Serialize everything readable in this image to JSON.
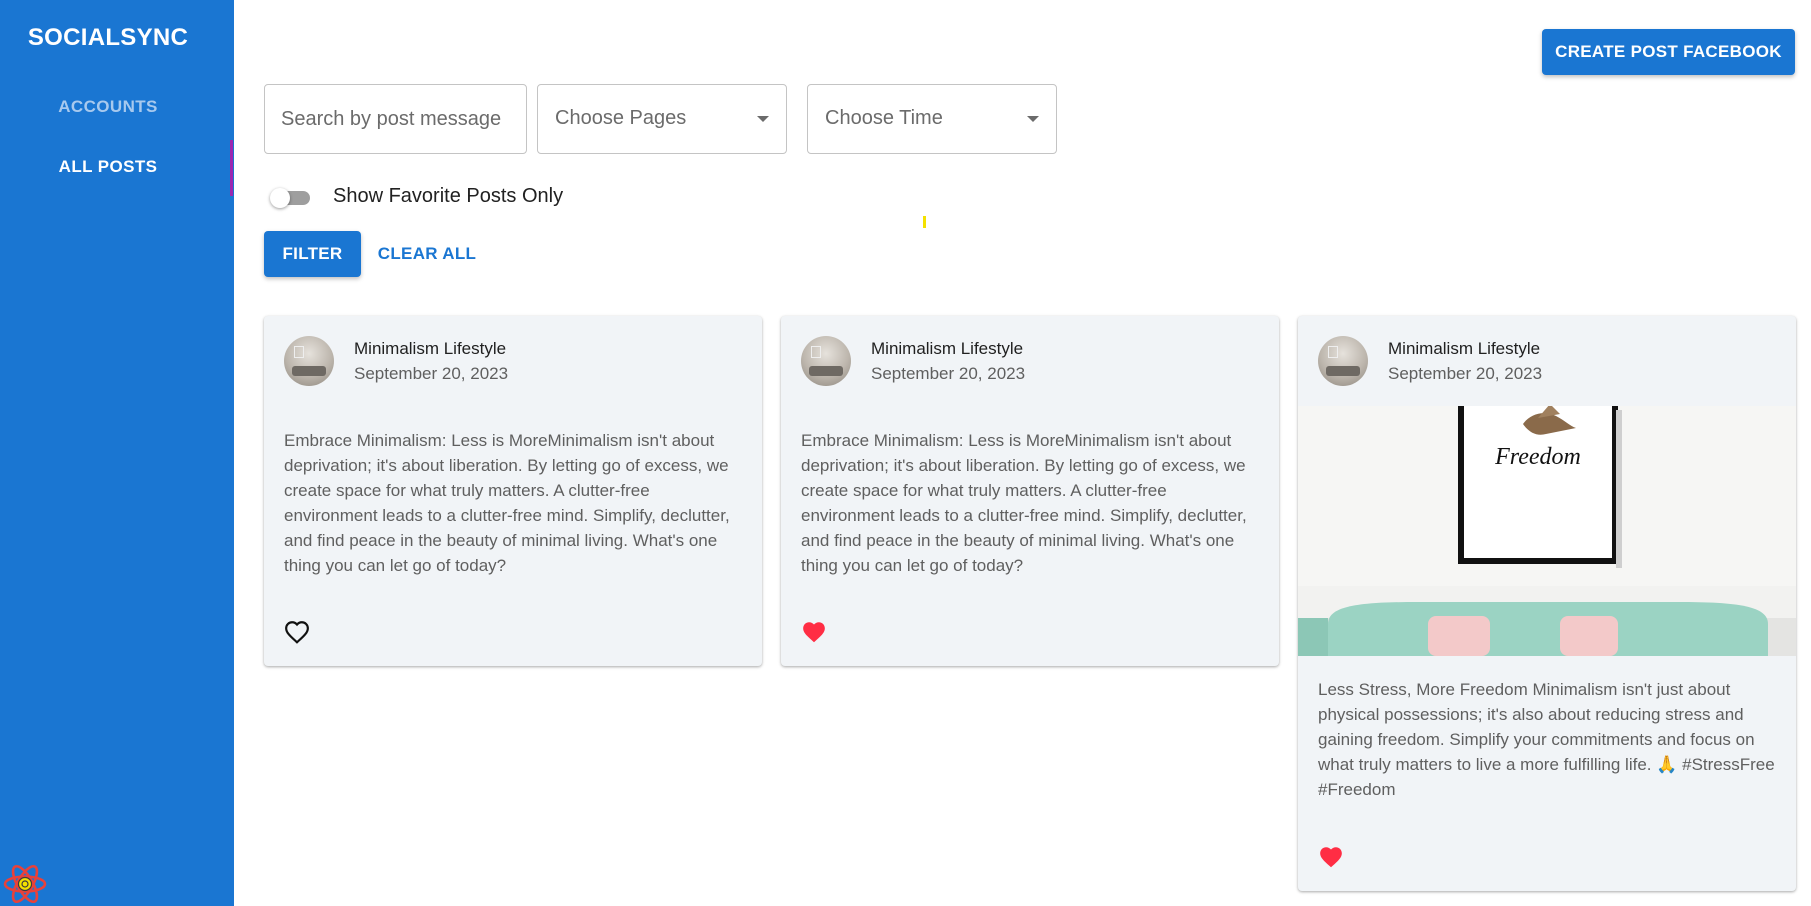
{
  "app": {
    "brand": "SOCIALSYNC",
    "nav": [
      {
        "label": "ACCOUNTS",
        "active": false
      },
      {
        "label": "ALL POSTS",
        "active": true
      }
    ]
  },
  "header": {
    "create_button_label": "CREATE POST FACEBOOK"
  },
  "filters": {
    "search": {
      "placeholder": "Search by post message",
      "value": ""
    },
    "pages": {
      "placeholder": "Choose Pages",
      "value": ""
    },
    "time": {
      "placeholder": "Choose Time",
      "value": ""
    },
    "favorites_toggle": {
      "label": "Show Favorite Posts Only",
      "checked": false
    },
    "filter_button_label": "FILTER",
    "clear_button_label": "CLEAR ALL"
  },
  "posts": [
    {
      "author": "Minimalism Lifestyle",
      "date": "September 20, 2023",
      "message": "Embrace Minimalism: Less is MoreMinimalism isn't about deprivation; it's about liberation. By letting go of excess, we create space for what truly matters. A clutter-free environment leads to a clutter-free mind. Simplify, declutter, and find peace in the beauty of minimal living. What's one thing you can let go of today?",
      "favorite": false,
      "has_image": false
    },
    {
      "author": "Minimalism Lifestyle",
      "date": "September 20, 2023",
      "message": "Embrace Minimalism: Less is MoreMinimalism isn't about deprivation; it's about liberation. By letting go of excess, we create space for what truly matters. A clutter-free environment leads to a clutter-free mind. Simplify, declutter, and find peace in the beauty of minimal living. What's one thing you can let go of today?",
      "favorite": true,
      "has_image": false
    },
    {
      "author": "Minimalism Lifestyle",
      "date": "September 20, 2023",
      "message": "Less Stress, More Freedom Minimalism isn't just about physical possessions; it's also about reducing stress and gaining freedom. Simplify your commitments and focus on what truly matters to live a more fulfilling life. 🙏 #StressFree #Freedom",
      "favorite": true,
      "has_image": true,
      "image_caption": "Freedom"
    }
  ],
  "colors": {
    "primary": "#1a76d2",
    "sidebar_bg": "#1a76d2",
    "card_bg": "#f1f4f7",
    "heart_red": "#ff2d44",
    "nav_active_marker": "#9c27b0"
  },
  "icons": {
    "heart_outline": "heart-outline-icon",
    "heart_filled": "heart-filled-icon",
    "dropdown": "caret-down-icon",
    "react": "react-logo-icon"
  }
}
